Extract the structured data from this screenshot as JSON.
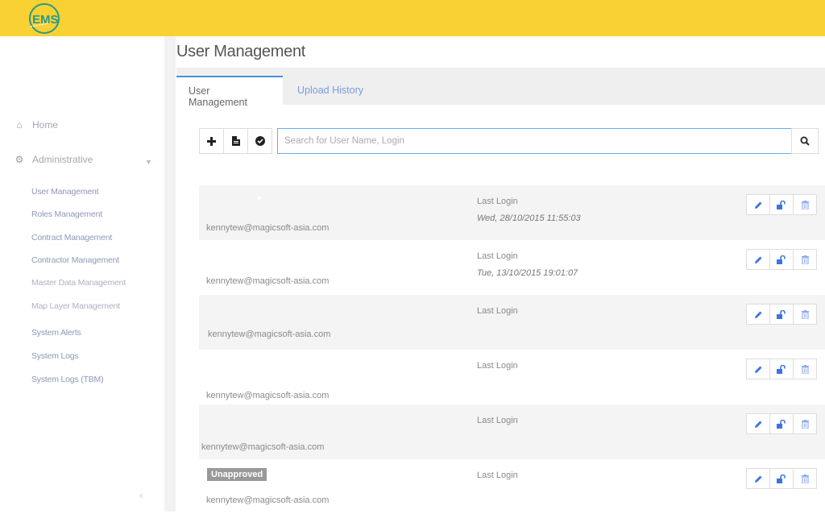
{
  "header": {
    "logo_text": "EMS",
    "brand_color": "#f9d132",
    "logo_color": "#2a9a8a"
  },
  "sidebar": {
    "main_items": [
      {
        "label": "Home",
        "icon": "home-icon"
      },
      {
        "label": "Administrative",
        "icon": "cogs-icon",
        "expanded": true
      }
    ],
    "sub_items": [
      {
        "label": "User Management"
      },
      {
        "label": "Roles Management"
      },
      {
        "label": "Contract Management"
      },
      {
        "label": "Contractor Management"
      },
      {
        "label": "Master Data Management"
      },
      {
        "label": "Map Layer Management"
      },
      {
        "label": "System Alerts"
      },
      {
        "label": "System Logs"
      },
      {
        "label": "System Logs (TBM)"
      }
    ],
    "collapse_glyph": "‹"
  },
  "page": {
    "title": "User Management",
    "tabs": [
      {
        "label": "User Management",
        "active": true
      },
      {
        "label": "Upload History",
        "active": false
      }
    ]
  },
  "toolbar": {
    "add_icon": "+",
    "search_placeholder": "Search for User Name, Login",
    "search_value": ""
  },
  "users": [
    {
      "email": "kennytew@magicsoft-asia.com",
      "last_login_label": "Last Login",
      "last_login": "Wed, 28/10/2015 11:55:03",
      "badge": ""
    },
    {
      "email": "kennytew@magicsoft-asia.com",
      "last_login_label": "Last Login",
      "last_login": "Tue, 13/10/2015 19:01:07",
      "badge": ""
    },
    {
      "email": "kennytew@magicsoft-asia.com",
      "last_login_label": "Last Login",
      "last_login": "",
      "badge": ""
    },
    {
      "email": "kennytew@magicsoft-asia.com",
      "last_login_label": "Last Login",
      "last_login": "",
      "badge": ""
    },
    {
      "email": "kennytew@magicsoft-asia.com",
      "last_login_label": "Last Login",
      "last_login": "",
      "badge": ""
    },
    {
      "email": "kennytew@magicsoft-asia.com",
      "last_login_label": "Last Login",
      "last_login": "",
      "badge": "Unapproved"
    }
  ],
  "colors": {
    "accent": "#4a90d9",
    "action_icon": "#3b73e6",
    "delete_icon": "#8aa6e8",
    "badge_bg": "#999999"
  }
}
